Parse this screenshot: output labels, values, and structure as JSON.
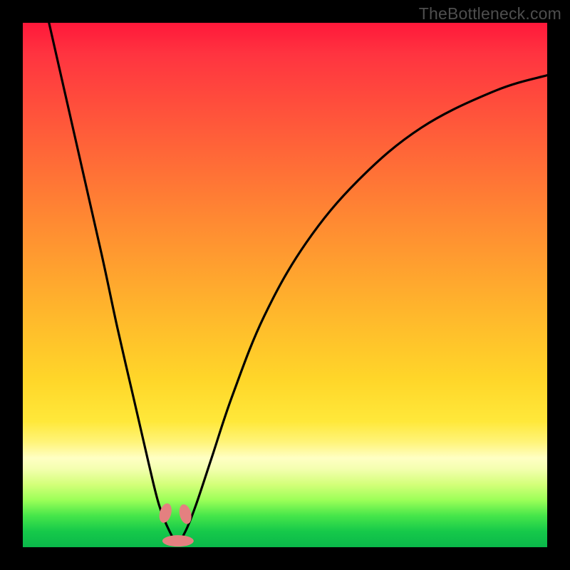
{
  "watermark": "TheBottleneck.com",
  "chart_data": {
    "type": "line",
    "title": "",
    "xlabel": "",
    "ylabel": "",
    "xlim": [
      0,
      100
    ],
    "ylim": [
      0,
      100
    ],
    "grid": false,
    "legend": false,
    "background_gradient": [
      "#ff183a",
      "#ff8a32",
      "#ffe83a",
      "#ffffc4",
      "#0ab84a"
    ],
    "series": [
      {
        "name": "bottleneck-curve",
        "x": [
          5,
          10,
          15,
          18,
          21,
          24,
          26,
          28,
          29.5,
          31,
          33,
          36,
          40,
          46,
          54,
          64,
          76,
          90,
          100
        ],
        "y": [
          100,
          78,
          56,
          42,
          29,
          16,
          8,
          3,
          1,
          3,
          8,
          17,
          29,
          44,
          58,
          70,
          80,
          87,
          90
        ]
      }
    ],
    "markers": [
      {
        "name": "marker-left",
        "x": 27.2,
        "y": 6.5
      },
      {
        "name": "marker-right",
        "x": 31.0,
        "y": 6.3
      },
      {
        "name": "marker-bottom",
        "x": 29.6,
        "y": 1.2
      }
    ]
  }
}
